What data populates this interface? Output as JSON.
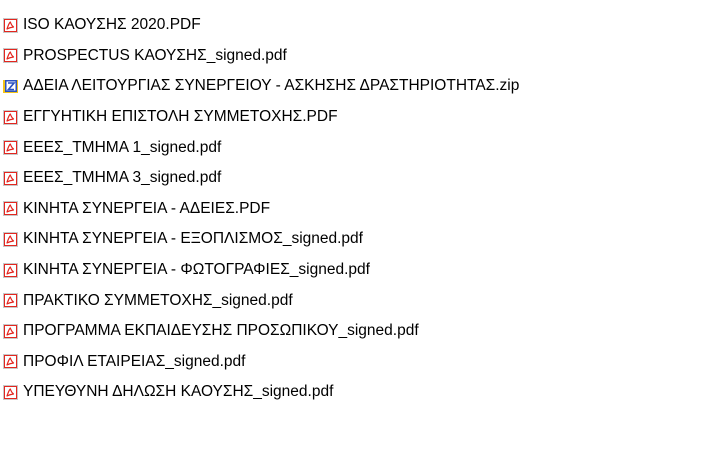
{
  "files": [
    {
      "name": "ISO ΚΑΟΥΣΗΣ 2020.PDF",
      "icon": "pdf-icon"
    },
    {
      "name": "PROSPECTUS ΚΑΟΥΣΗΣ_signed.pdf",
      "icon": "pdf-icon"
    },
    {
      "name": "ΑΔΕΙΑ ΛΕΙΤΟΥΡΓΙΑΣ ΣΥΝΕΡΓΕΙΟΥ - ΑΣΚΗΣΗΣ ΔΡΑΣΤΗΡΙΟΤΗΤΑΣ.zip",
      "icon": "zip-icon"
    },
    {
      "name": "ΕΓΓΥΗΤΙΚΗ ΕΠΙΣΤΟΛΗ ΣΥΜΜΕΤΟΧΗΣ.PDF",
      "icon": "pdf-icon"
    },
    {
      "name": "ΕΕΕΣ_ΤΜΗΜΑ 1_signed.pdf",
      "icon": "pdf-icon"
    },
    {
      "name": "ΕΕΕΣ_ΤΜΗΜΑ 3_signed.pdf",
      "icon": "pdf-icon"
    },
    {
      "name": "ΚΙΝΗΤΑ ΣΥΝΕΡΓΕΙΑ - ΑΔΕΙΕΣ.PDF",
      "icon": "pdf-icon"
    },
    {
      "name": "ΚΙΝΗΤΑ ΣΥΝΕΡΓΕΙΑ - ΕΞΟΠΛΙΣΜΟΣ_signed.pdf",
      "icon": "pdf-icon"
    },
    {
      "name": "ΚΙΝΗΤΑ ΣΥΝΕΡΓΕΙΑ - ΦΩΤΟΓΡΑΦΙΕΣ_signed.pdf",
      "icon": "pdf-icon"
    },
    {
      "name": "ΠΡΑΚΤΙΚΟ ΣΥΜΜΕΤΟΧΗΣ_signed.pdf",
      "icon": "pdf-icon"
    },
    {
      "name": "ΠΡΟΓΡΑΜΜΑ ΕΚΠΑΙΔΕΥΣΗΣ ΠΡΟΣΩΠΙΚΟΥ_signed.pdf",
      "icon": "pdf-icon"
    },
    {
      "name": "ΠΡΟΦΙΛ ΕΤΑΙΡΕΙΑΣ_signed.pdf",
      "icon": "pdf-icon"
    },
    {
      "name": "ΥΠΕΥΘΥΝΗ ΔΗΛΩΣΗ ΚΑΟΥΣΗΣ_signed.pdf",
      "icon": "pdf-icon"
    }
  ],
  "colors": {
    "pdf_red": "#e3261f",
    "zip_blue": "#2a52be",
    "zip_yellow": "#f2c318",
    "text": "#000000"
  }
}
